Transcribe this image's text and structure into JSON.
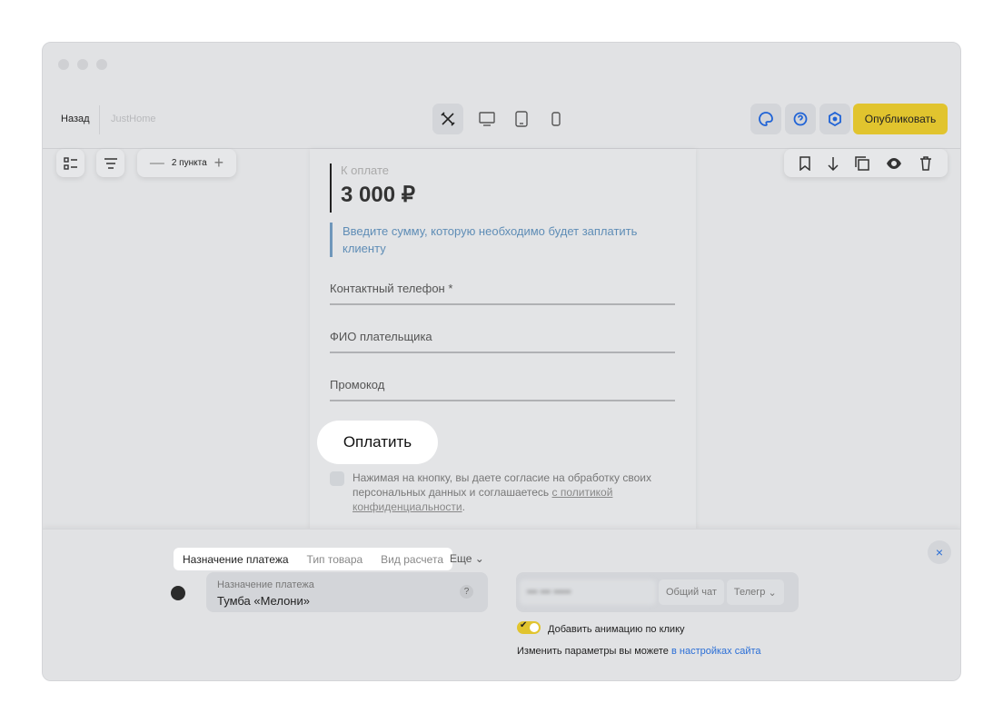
{
  "header": {
    "back": "Назад",
    "site": "JustHome",
    "publish": "Опубликовать"
  },
  "toolbar": {
    "points": "2 пункта"
  },
  "form": {
    "amount_label": "К оплате",
    "amount": "3 000 ₽",
    "hint": "Введите сумму, которую необходимо будет заплатить клиенту",
    "fields": [
      "Контактный телефон *",
      "ФИО плательщика",
      "Промокод"
    ],
    "pay": "Оплатить",
    "agree_text": "Нажимая на кнопку, вы даете согласие на обработку своих персональных данных и соглашаетесь ",
    "agree_link": "с политикой конфиденциальности",
    "agree_end": "."
  },
  "panel": {
    "tabs": [
      "Назначение платежа",
      "Тип товара",
      "Вид расчета"
    ],
    "more": "Еще",
    "input_label": "Назначение платежа",
    "input_value": "Тумба «Мелони»",
    "help": "?",
    "chips": [
      "••• ••• •••••",
      "Общий чат",
      "Телегр"
    ],
    "toggle_label": "Добавить анимацию по клику",
    "toggle_on": true,
    "note": "Изменить параметры вы можете ",
    "note_link": "в настройках сайта",
    "close": "×"
  },
  "colors": {
    "accent": "#e1c42e",
    "link": "#2a6ed6",
    "hint": "#5f8db6"
  }
}
